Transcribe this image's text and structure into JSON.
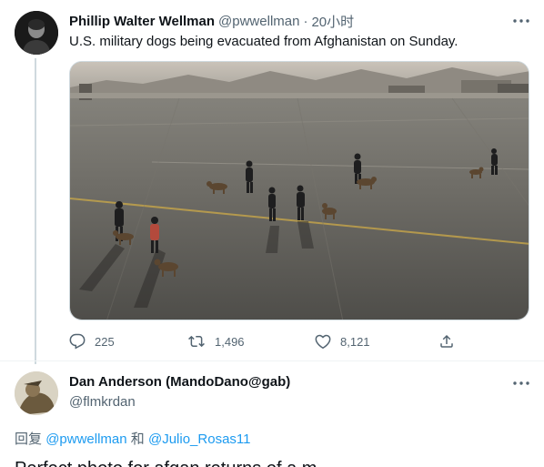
{
  "tweet": {
    "author_name": "Phillip Walter Wellman",
    "author_handle": "@pwwellman",
    "separator": "·",
    "time": "20小时",
    "text": "U.S. military dogs being evacuated from Afghanistan on Sunday.",
    "stats": {
      "replies": "225",
      "retweets": "1,496",
      "likes": "8,121"
    }
  },
  "reply": {
    "author_name": "Dan Anderson (MandoDano@gab)",
    "author_handle": "@flmkrdan",
    "replying_prefix": "回复",
    "mention_1": "@pwwellman",
    "conjunction": "和",
    "mention_2": "@Julio_Rosas11",
    "text_start": "Perfect photo for afgan returns of a m"
  },
  "icons": {
    "more": "more-horizontal-icon",
    "reply": "reply-icon",
    "retweet": "retweet-icon",
    "like": "heart-icon",
    "share": "share-icon"
  },
  "colors": {
    "accent": "#1d9bf0",
    "secondary_text": "#536471",
    "primary_text": "#0f1419",
    "thread_line": "#cfd9de"
  }
}
